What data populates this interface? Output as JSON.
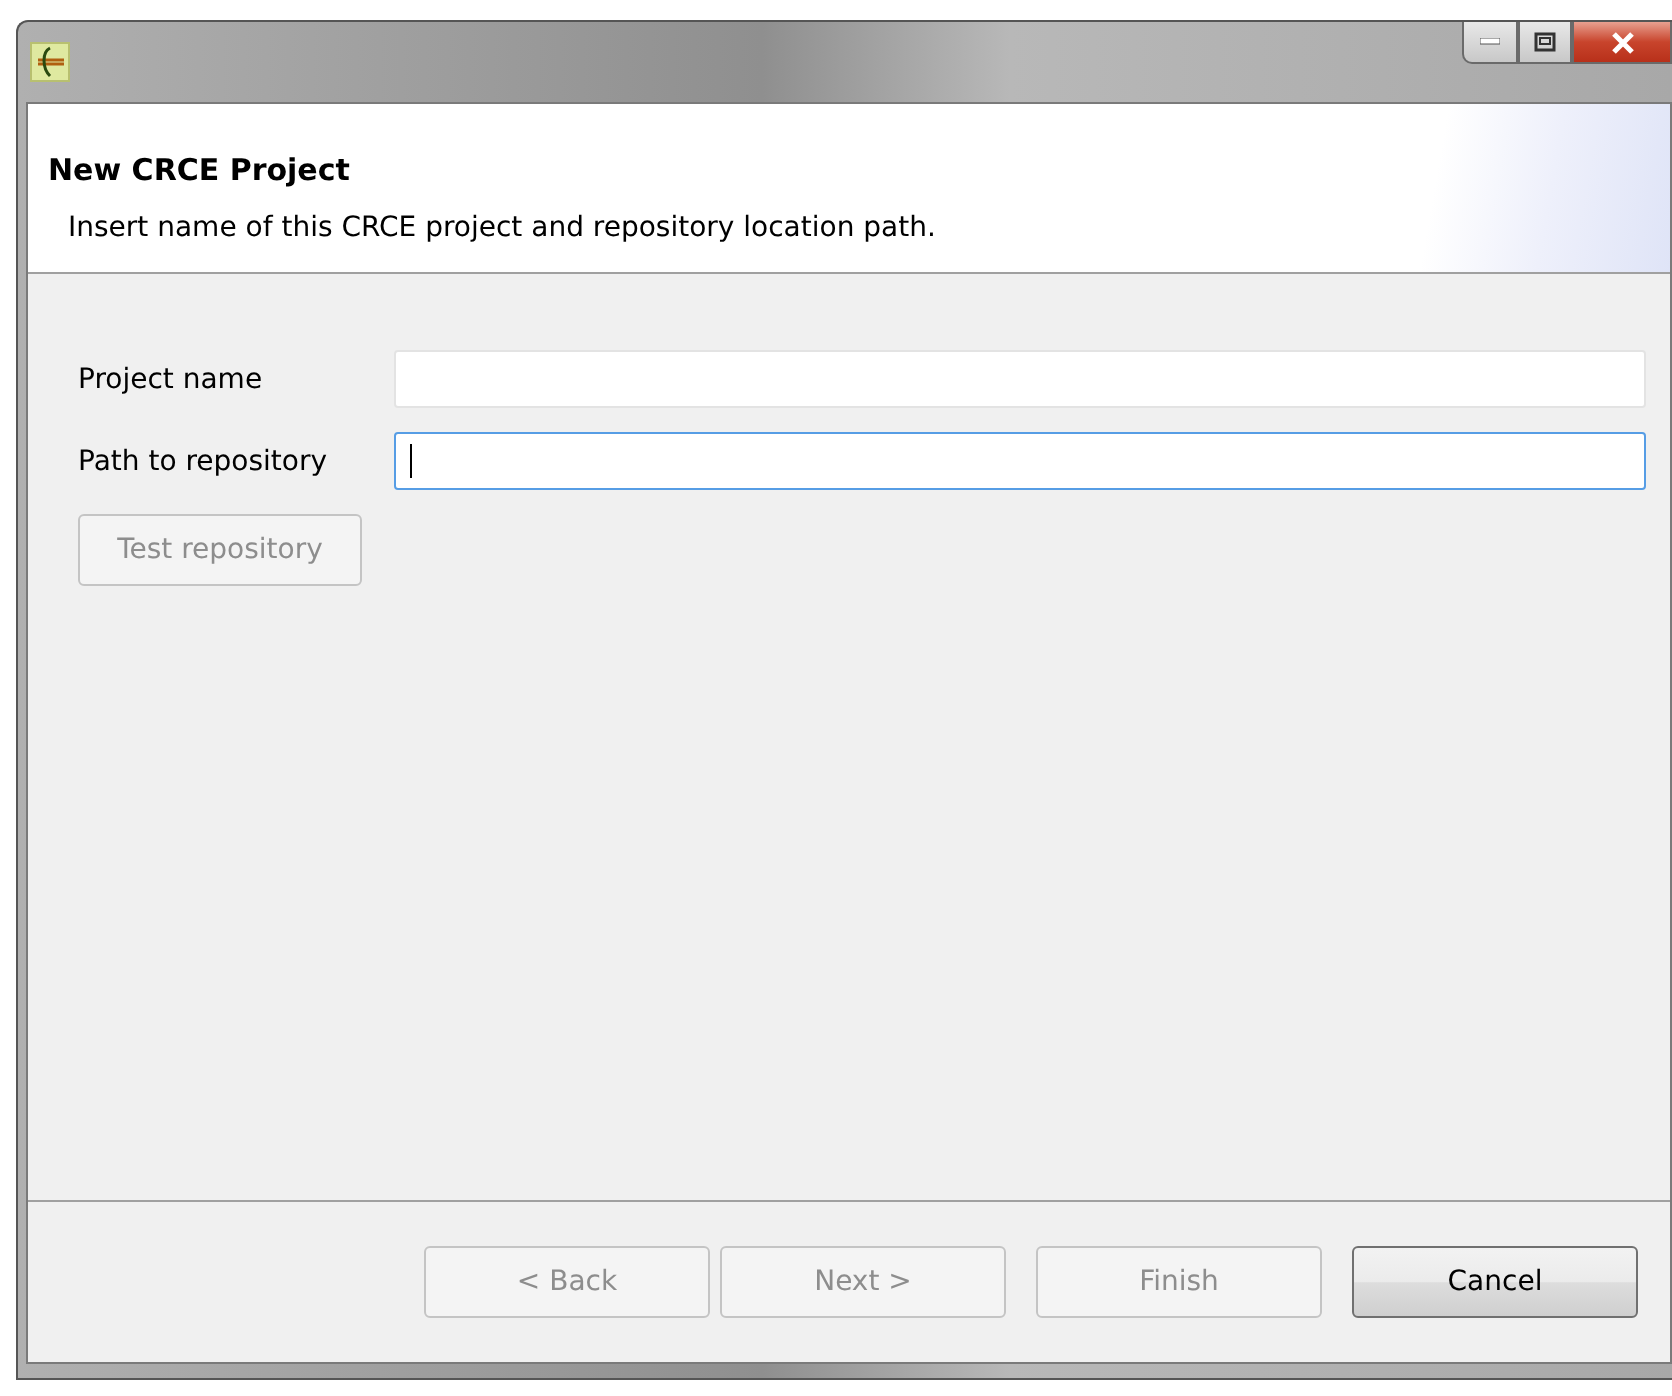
{
  "window": {
    "title_buttons": [
      {
        "kind": "minimize"
      },
      {
        "kind": "maximize"
      },
      {
        "kind": "close"
      }
    ]
  },
  "header": {
    "title": "New CRCE Project",
    "description": "Insert name of this CRCE project and repository location path."
  },
  "form": {
    "fields": [
      {
        "label": "Project name",
        "focused": false
      },
      {
        "label": "Path to repository",
        "focused": true
      }
    ],
    "test_button": {
      "label": "Test repository",
      "disabled": true
    }
  },
  "buttons": [
    {
      "label": "< Back",
      "disabled": true
    },
    {
      "label": "Next >",
      "disabled": true
    },
    {
      "label": "Finish",
      "disabled": true
    },
    {
      "label": "Cancel",
      "disabled": false
    }
  ]
}
